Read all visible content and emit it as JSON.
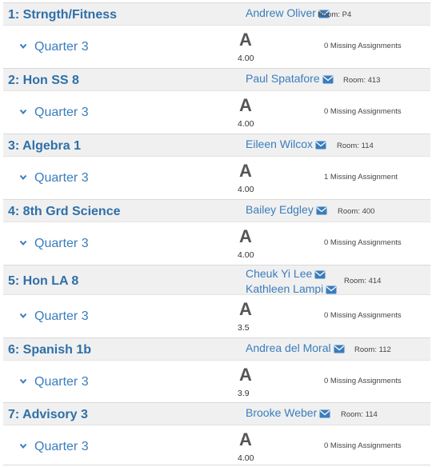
{
  "courses": [
    {
      "title": "1: Strngth/Fitness",
      "teachers": [
        "Andrew Oliver"
      ],
      "room": "Room: P4",
      "term": "Quarter 3",
      "grade": "A",
      "gpa": "4.00",
      "missing": "0 Missing Assignments"
    },
    {
      "title": "2: Hon SS 8",
      "teachers": [
        "Paul Spatafore"
      ],
      "room": "Room: 413",
      "term": "Quarter 3",
      "grade": "A",
      "gpa": "4.00",
      "missing": "0 Missing Assignments"
    },
    {
      "title": "3: Algebra 1",
      "teachers": [
        "Eileen Wilcox"
      ],
      "room": "Room: 114",
      "term": "Quarter 3",
      "grade": "A",
      "gpa": "4.00",
      "missing": "1 Missing Assignment"
    },
    {
      "title": "4: 8th Grd Science",
      "teachers": [
        "Bailey Edgley"
      ],
      "room": "Room: 400",
      "term": "Quarter 3",
      "grade": "A",
      "gpa": "4.00",
      "missing": "0 Missing Assignments"
    },
    {
      "title": "5: Hon LA 8",
      "teachers": [
        "Cheuk Yi Lee",
        "Kathleen Lampi"
      ],
      "room": "Room: 414",
      "term": "Quarter 3",
      "grade": "A",
      "gpa": "3.5",
      "missing": "0 Missing Assignments"
    },
    {
      "title": "6: Spanish 1b",
      "teachers": [
        "Andrea del Moral"
      ],
      "room": "Room: 112",
      "term": "Quarter 3",
      "grade": "A",
      "gpa": "3.9",
      "missing": "0 Missing Assignments"
    },
    {
      "title": "7: Advisory 3",
      "teachers": [
        "Brooke Weber"
      ],
      "room": "Room: 114",
      "term": "Quarter 3",
      "grade": "A",
      "gpa": "4.00",
      "missing": "0 Missing Assignments"
    }
  ],
  "icons": {
    "mail": "envelope-icon",
    "expand": "chevron-down-icon"
  },
  "colors": {
    "link": "#3a7dbc",
    "title": "#2f6fa8",
    "header_bg": "#f0f0f0",
    "grade": "#555555"
  }
}
